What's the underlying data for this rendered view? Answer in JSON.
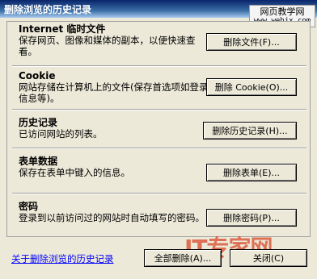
{
  "window": {
    "title": "删除浏览的历史记录"
  },
  "watermark": {
    "line1": "网页教学网",
    "line2": "www.webjx.com"
  },
  "sections": [
    {
      "heading": "Internet 临时文件",
      "desc": "保存网页、图像和媒体的副本，以便快速查看。",
      "button": "删除文件(F)..."
    },
    {
      "heading": "Cookie",
      "desc": "网站存储在计算机上的文件(保存首选项如登录信息等)。",
      "button": "删除 Cookie(O)..."
    },
    {
      "heading": "历史记录",
      "desc": "已访问网站的列表。",
      "button": "删除历史记录(H)..."
    },
    {
      "heading": "表单数据",
      "desc": "保存在表单中键入的信息。",
      "button": "删除表单(E)..."
    },
    {
      "heading": "密码",
      "desc": "登录到以前访问过的网站时自动填写的密码。",
      "button": "删除密码(P)..."
    }
  ],
  "footer": {
    "about_link": "关于删除浏览的历史记录",
    "delete_all_button": "全部删除(A)...",
    "close_button": "关闭(C)"
  },
  "logo": {
    "text": "IT专家网"
  }
}
